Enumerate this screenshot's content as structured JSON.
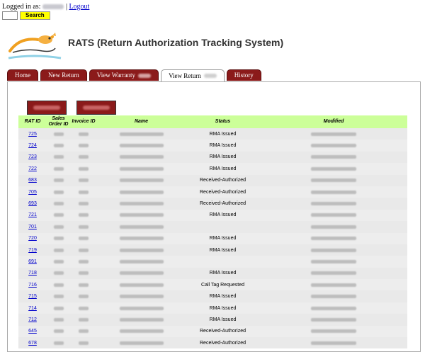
{
  "header": {
    "logged_in_label": "Logged in as:",
    "separator": "|",
    "logout_label": "Logout",
    "search_button_label": "Search",
    "search_value": ""
  },
  "app": {
    "title": "RATS (Return Authorization Tracking System)"
  },
  "tabs": [
    {
      "label": "Home",
      "active": false
    },
    {
      "label": "New Return",
      "active": false
    },
    {
      "label": "View Warranty",
      "active": false
    },
    {
      "label": "View Return",
      "active": true
    },
    {
      "label": "History",
      "active": false
    }
  ],
  "table": {
    "columns": [
      "RAT ID",
      "Sales Order ID",
      "Invoice ID",
      "Name",
      "Status",
      "Modified"
    ],
    "rows": [
      {
        "rat_id": "725",
        "status": "RMA Issued"
      },
      {
        "rat_id": "724",
        "status": "RMA Issued"
      },
      {
        "rat_id": "723",
        "status": "RMA Issued"
      },
      {
        "rat_id": "722",
        "status": "RMA Issued"
      },
      {
        "rat_id": "683",
        "status": "Received-Authorized"
      },
      {
        "rat_id": "705",
        "status": "Received-Authorized"
      },
      {
        "rat_id": "693",
        "status": "Received-Authorized"
      },
      {
        "rat_id": "721",
        "status": "RMA Issued"
      },
      {
        "rat_id": "701",
        "status": ""
      },
      {
        "rat_id": "720",
        "status": "RMA Issued"
      },
      {
        "rat_id": "719",
        "status": "RMA Issued"
      },
      {
        "rat_id": "691",
        "status": ""
      },
      {
        "rat_id": "718",
        "status": "RMA Issued"
      },
      {
        "rat_id": "716",
        "status": "Call Tag Requested"
      },
      {
        "rat_id": "715",
        "status": "RMA Issued"
      },
      {
        "rat_id": "714",
        "status": "RMA Issued"
      },
      {
        "rat_id": "712",
        "status": "RMA Issued"
      },
      {
        "rat_id": "645",
        "status": "Received-Authorized"
      },
      {
        "rat_id": "678",
        "status": "Received-Authorized"
      }
    ]
  }
}
